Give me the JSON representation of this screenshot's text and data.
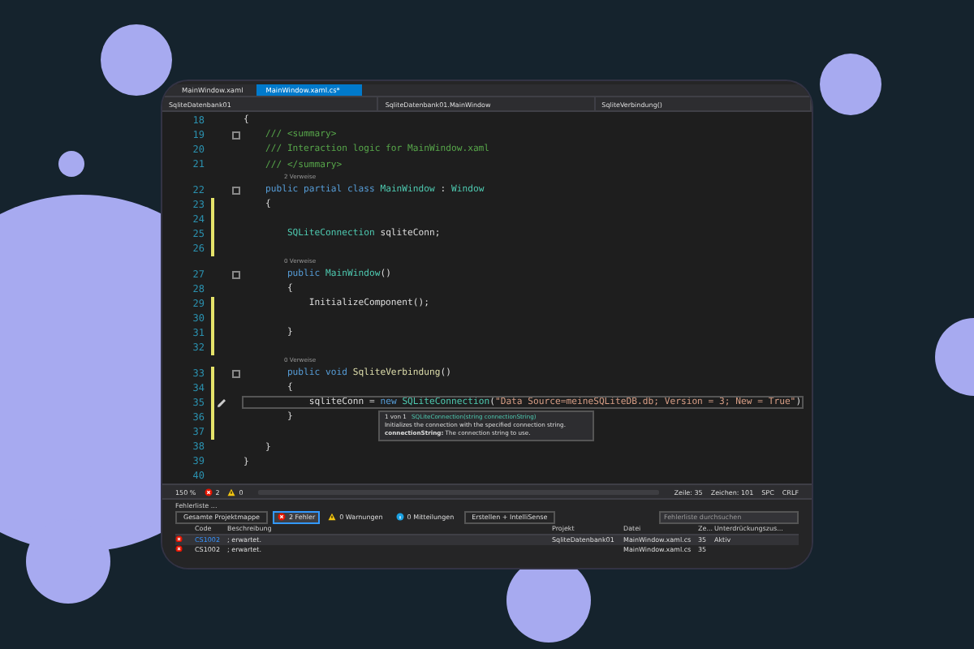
{
  "tabs": [
    {
      "label": "MainWindow.xaml",
      "selected": false
    },
    {
      "label": "MainWindow.xaml.cs*",
      "selected": true
    }
  ],
  "nav_bar": [
    "SqliteDatenbank01",
    "SqliteDatenbank01.MainWindow",
    "SqliteVerbindung()"
  ],
  "code_lines": [
    {
      "kind": "code",
      "number": "18",
      "fold": false,
      "changed": false,
      "current": false,
      "tokens": [
        {
          "kind": "plain",
          "text": "{"
        }
      ]
    },
    {
      "kind": "code",
      "number": "19",
      "fold": true,
      "changed": false,
      "current": false,
      "tokens": [
        {
          "kind": "comment",
          "text": "    /// <summary>"
        }
      ]
    },
    {
      "kind": "code",
      "number": "20",
      "fold": false,
      "changed": false,
      "current": false,
      "tokens": [
        {
          "kind": "comment",
          "text": "    /// Interaction logic for MainWindow.xaml"
        }
      ]
    },
    {
      "kind": "code",
      "number": "21",
      "fold": false,
      "changed": false,
      "current": false,
      "tokens": [
        {
          "kind": "comment",
          "text": "    /// </summary>"
        }
      ]
    },
    {
      "kind": "codelens",
      "text": "2 Verweise"
    },
    {
      "kind": "code",
      "number": "22",
      "fold": true,
      "changed": false,
      "current": false,
      "tokens": [
        {
          "kind": "keyword",
          "text": "    public partial class "
        },
        {
          "kind": "type",
          "text": "MainWindow"
        },
        {
          "kind": "plain",
          "text": " : "
        },
        {
          "kind": "type",
          "text": "Window"
        }
      ]
    },
    {
      "kind": "code",
      "number": "23",
      "fold": false,
      "changed": true,
      "current": false,
      "tokens": [
        {
          "kind": "plain",
          "text": "    {"
        }
      ]
    },
    {
      "kind": "code",
      "number": "24",
      "fold": false,
      "changed": true,
      "current": false
    },
    {
      "kind": "code",
      "number": "25",
      "fold": false,
      "changed": true,
      "current": false,
      "tokens": [
        {
          "kind": "type",
          "text": "        SQLiteConnection"
        },
        {
          "kind": "plain",
          "text": " sqliteConn;"
        }
      ]
    },
    {
      "kind": "code",
      "number": "26",
      "fold": false,
      "changed": true,
      "current": false
    },
    {
      "kind": "codelens",
      "text": "0 Verweise"
    },
    {
      "kind": "code",
      "number": "27",
      "fold": true,
      "changed": false,
      "current": false,
      "tokens": [
        {
          "kind": "keyword",
          "text": "        public "
        },
        {
          "kind": "type",
          "text": "MainWindow"
        },
        {
          "kind": "plain",
          "text": "()"
        }
      ]
    },
    {
      "kind": "code",
      "number": "28",
      "fold": false,
      "changed": false,
      "current": false,
      "tokens": [
        {
          "kind": "plain",
          "text": "        {"
        }
      ]
    },
    {
      "kind": "code",
      "number": "29",
      "fold": false,
      "changed": true,
      "current": false,
      "tokens": [
        {
          "kind": "plain",
          "text": "            InitializeComponent();"
        }
      ]
    },
    {
      "kind": "code",
      "number": "30",
      "fold": false,
      "changed": true,
      "current": false
    },
    {
      "kind": "code",
      "number": "31",
      "fold": false,
      "changed": true,
      "current": false,
      "tokens": [
        {
          "kind": "plain",
          "text": "        }"
        }
      ]
    },
    {
      "kind": "code",
      "number": "32",
      "fold": false,
      "changed": true,
      "current": false
    },
    {
      "kind": "codelens",
      "text": "0 Verweise"
    },
    {
      "kind": "code",
      "number": "33",
      "fold": true,
      "changed": true,
      "current": false,
      "tokens": [
        {
          "kind": "keyword",
          "text": "        public void "
        },
        {
          "kind": "method",
          "text": "SqliteVerbindung"
        },
        {
          "kind": "plain",
          "text": "()"
        }
      ]
    },
    {
      "kind": "code",
      "number": "34",
      "fold": false,
      "changed": true,
      "current": false,
      "tokens": [
        {
          "kind": "plain",
          "text": "        {"
        }
      ]
    },
    {
      "kind": "code",
      "number": "35",
      "fold": false,
      "changed": true,
      "current": true,
      "tokens": [
        {
          "kind": "plain",
          "text": "            sqliteConn = "
        },
        {
          "kind": "keyword",
          "text": "new "
        },
        {
          "kind": "type",
          "text": "SQLiteConnection"
        },
        {
          "kind": "plain",
          "text": "("
        },
        {
          "kind": "string",
          "text": "\"Data Source=meineSQLiteDB.db; Version = 3; New = True\""
        },
        {
          "kind": "plain",
          "text": ")"
        }
      ]
    },
    {
      "kind": "code",
      "number": "36",
      "fold": false,
      "changed": true,
      "current": false,
      "tokens": [
        {
          "kind": "plain",
          "text": "        }"
        }
      ]
    },
    {
      "kind": "code",
      "number": "37",
      "fold": false,
      "changed": true,
      "current": false
    },
    {
      "kind": "code",
      "number": "38",
      "fold": false,
      "changed": false,
      "current": false,
      "tokens": [
        {
          "kind": "plain",
          "text": "    }"
        }
      ]
    },
    {
      "kind": "code",
      "number": "39",
      "fold": false,
      "changed": false,
      "current": false,
      "tokens": [
        {
          "kind": "plain",
          "text": "}"
        }
      ]
    },
    {
      "kind": "code",
      "number": "40",
      "fold": false,
      "changed": false,
      "current": false
    }
  ],
  "tooltip": {
    "counter": "1 von 1",
    "signature": "SQLiteConnection(string connectionString)",
    "description": "Initializes the connection with the specified connection string.",
    "parameter": "**connectionString:** The connection string to use."
  },
  "status_bar": {
    "zoom": "150 %",
    "errors": "2",
    "warnings": "0",
    "line": "Zeile: 35",
    "column": "Zeichen: 101",
    "whitespace": "SPC",
    "line_ending": "CRLF"
  },
  "error_list": {
    "title": "Fehlerliste ...",
    "scope": "Gesamte Projektmappe",
    "filters": [
      {
        "kind": "error",
        "label": "2 Fehler",
        "selected": true
      },
      {
        "kind": "warning",
        "label": "0 Warnungen",
        "selected": false
      },
      {
        "kind": "info",
        "label": "0 Mitteilungen",
        "selected": false
      }
    ],
    "build_filter": "Erstellen + IntelliSense",
    "search": {
      "placeholder": "Fehlerliste durchsuchen"
    },
    "columns": [
      "Code",
      "Beschreibung",
      "Projekt",
      "Datei",
      "Ze...",
      "Unterdrückungszus..."
    ],
    "rows": [
      {
        "selected": true,
        "cells": [
          "CS1002",
          "; erwartet.",
          "SqliteDatenbank01",
          "MainWindow.xaml.cs",
          "35",
          "Aktiv"
        ]
      },
      {
        "selected": false,
        "cells": [
          "CS1002",
          "; erwartet.",
          "",
          "MainWindow.xaml.cs",
          "35",
          ""
        ]
      }
    ]
  }
}
